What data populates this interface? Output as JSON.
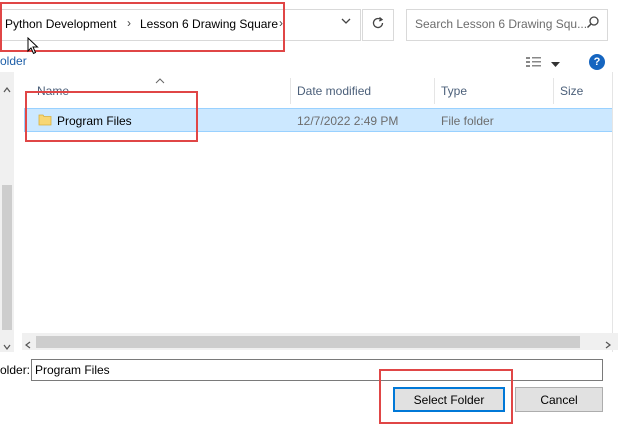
{
  "address_bar": {
    "breadcrumbs": [
      "Python Development",
      "Lesson 6 Drawing Square"
    ],
    "separator": "›"
  },
  "search": {
    "placeholder": "Search Lesson 6 Drawing Squ..."
  },
  "toolbar": {
    "left_label": "older"
  },
  "columns": [
    "Name",
    "Date modified",
    "Type",
    "Size"
  ],
  "files": [
    {
      "name": "Program Files",
      "date_modified": "12/7/2022 2:49 PM",
      "type": "File folder",
      "size": ""
    }
  ],
  "folder_field": {
    "label": "older:",
    "value": "Program Files"
  },
  "buttons": {
    "select": "Select Folder",
    "cancel": "Cancel"
  },
  "help_glyph": "?",
  "icons": [
    "chevron-down-icon",
    "refresh-icon",
    "search-icon",
    "view-details-icon",
    "help-icon",
    "folder-icon",
    "mouse-cursor-icon"
  ],
  "colors": {
    "highlight": "#e04646",
    "selection": "#cce8ff",
    "accent": "#0078d7"
  }
}
